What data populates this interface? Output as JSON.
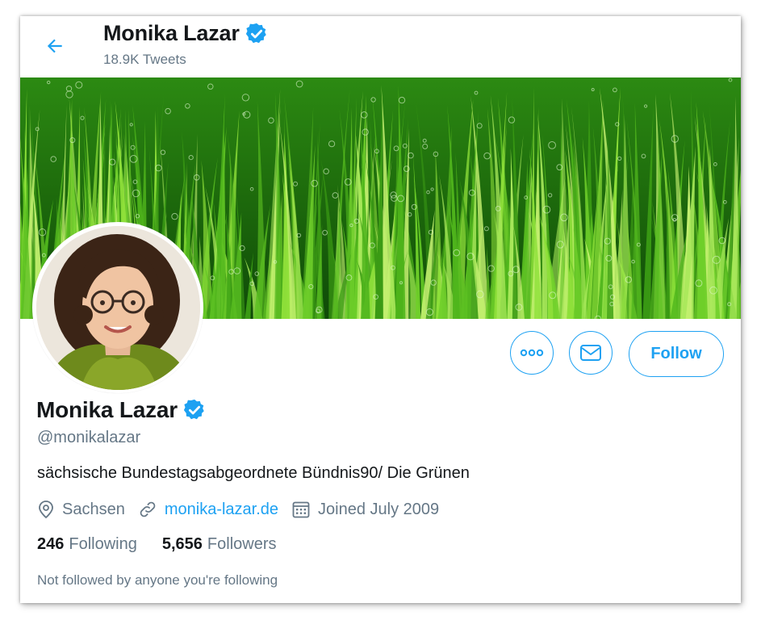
{
  "header": {
    "title": "Monika Lazar",
    "tweet_count": "18.9K Tweets"
  },
  "profile": {
    "name": "Monika Lazar",
    "handle": "@monikalazar",
    "bio": "sächsische Bundestagsabgeordnete Bündnis90/ Die Grünen",
    "location": "Sachsen",
    "website": "monika-lazar.de",
    "joined": "Joined July 2009",
    "verified": true
  },
  "stats": {
    "following_count": "246",
    "following_label": "Following",
    "followers_count": "5,656",
    "followers_label": "Followers"
  },
  "actions": {
    "follow_label": "Follow"
  },
  "footer": {
    "not_followed": "Not followed by anyone you're following"
  },
  "icons": {
    "back": "arrow-left-icon",
    "verified": "verified-badge-icon",
    "more": "more-horizontal-icon",
    "message": "envelope-icon",
    "location": "location-pin-icon",
    "link": "link-icon",
    "calendar": "calendar-icon"
  },
  "colors": {
    "accent": "#1da1f2",
    "text_primary": "#14171a",
    "text_secondary": "#657786"
  }
}
